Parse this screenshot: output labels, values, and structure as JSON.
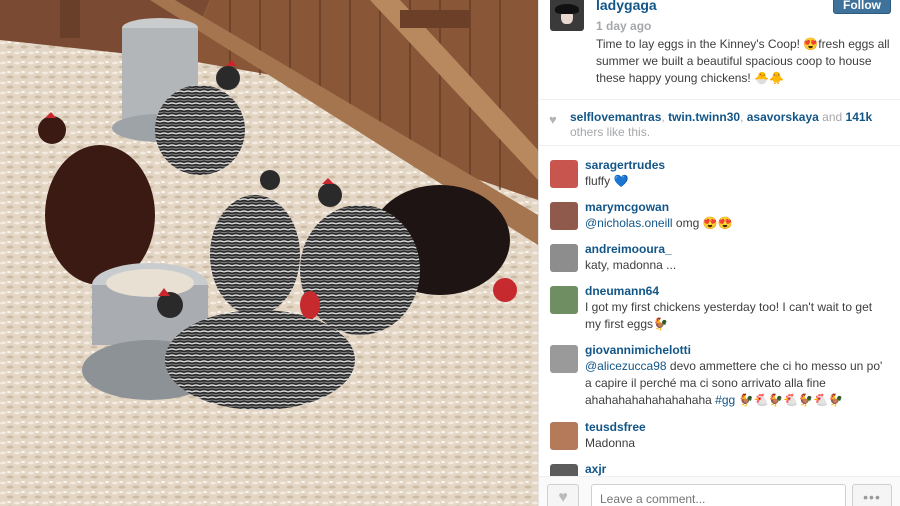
{
  "post": {
    "username": "ladygaga",
    "time": "1 day ago",
    "follow_label": "Follow",
    "caption": "Time to lay eggs in the Kinney's Coop! 😍fresh eggs all summer we built a beautiful spacious coop to house these happy young chickens! 🐣🐥"
  },
  "likes": {
    "users": [
      "selflovemantras",
      "twin.twinn30",
      "asavorskaya"
    ],
    "sep1": ", ",
    "sep2": ", ",
    "and_text": " and ",
    "count": "141k",
    "suffix": " others like this."
  },
  "comments": [
    {
      "username": "saragertrudes",
      "text": "fluffy 💙"
    },
    {
      "username": "marymcgowan",
      "mention": "@nicholas.oneill",
      "text": " omg 😍😍"
    },
    {
      "username": "andreimooura_",
      "text": "katy, madonna ..."
    },
    {
      "username": "dneumann64",
      "text": "I got my first chickens yesterday too! I can't wait to get my first eggs🐓"
    },
    {
      "username": "giovannimichelotti",
      "mention": "@alicezucca98",
      "text": " devo ammettere che ci ho messo un po' a capire il perché ma ci sono arrivato alla fine ahahahahahahahahaha ",
      "hashtag": "#gg",
      "emoji": "🐓🐔🐓🐔🐓🐔🐓"
    },
    {
      "username": "teusdsfree",
      "text": "Madonna"
    },
    {
      "username": "axjr",
      "text": ""
    }
  ],
  "footer": {
    "comment_placeholder": "Leave a comment...",
    "more_label": "•••"
  },
  "icons": {
    "heart": "♥"
  },
  "colors": {
    "username": "#125688",
    "follow_bg": "#3f729b",
    "text": "#3d3d3d",
    "muted": "#a5a7aa"
  }
}
